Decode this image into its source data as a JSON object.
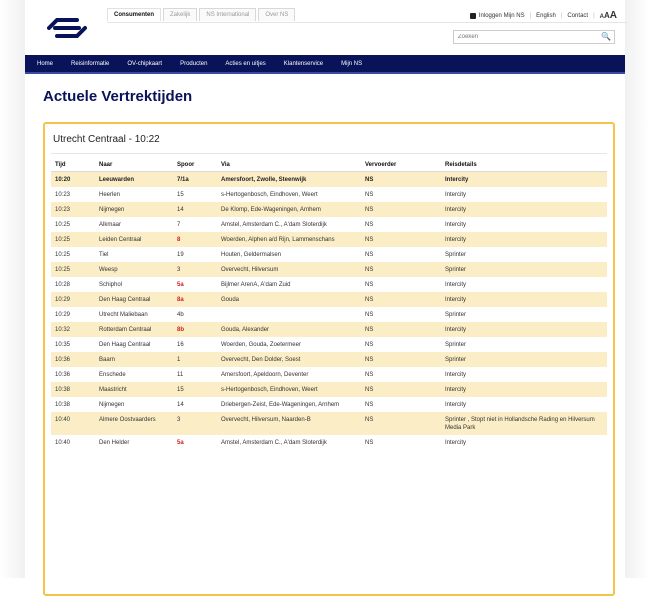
{
  "header": {
    "tabs": [
      "Consumenten",
      "Zakelijk",
      "NS International",
      "Over NS"
    ],
    "active_tab": 0,
    "utils": {
      "login": "Inloggen Mijn NS",
      "english": "English",
      "contact": "Contact",
      "font_sizes": [
        "A",
        "A",
        "A"
      ]
    },
    "search_placeholder": "Zoeken"
  },
  "nav": [
    "Home",
    "Reisinformatie",
    "OV-chipkaart",
    "Producten",
    "Acties en uitjes",
    "Klantenservice",
    "Mijn NS"
  ],
  "page_title": "Actuele Vertrektijden",
  "board": {
    "title": "Utrecht Centraal - 10:22",
    "columns": [
      "Tijd",
      "Naar",
      "Spoor",
      "Via",
      "Vervoerder",
      "Reisdetails"
    ],
    "rows": [
      {
        "tijd": "10:20",
        "naar": "Leeuwarden",
        "spoor": "7/1a",
        "spoor_changed": true,
        "via": "Amersfoort, Zwolle, Steenwijk",
        "vervoerder": "NS",
        "details": "Intercity"
      },
      {
        "tijd": "10:23",
        "naar": "Heerlen",
        "spoor": "15",
        "spoor_changed": false,
        "via": "s-Hertogenbosch, Eindhoven, Weert",
        "vervoerder": "NS",
        "details": "Intercity"
      },
      {
        "tijd": "10:23",
        "naar": "Nijmegen",
        "spoor": "14",
        "spoor_changed": false,
        "via": "De Klomp, Ede-Wageningen, Arnhem",
        "vervoerder": "NS",
        "details": "Intercity"
      },
      {
        "tijd": "10:25",
        "naar": "Alkmaar",
        "spoor": "7",
        "spoor_changed": false,
        "via": "Amstel, Amsterdam C., A'dam Sloterdijk",
        "vervoerder": "NS",
        "details": "Intercity"
      },
      {
        "tijd": "10:25",
        "naar": "Leiden Centraal",
        "spoor": "8",
        "spoor_changed": true,
        "via": "Woerden, Alphen a/d Rijn, Lammenschans",
        "vervoerder": "NS",
        "details": "Intercity"
      },
      {
        "tijd": "10:25",
        "naar": "Tiel",
        "spoor": "19",
        "spoor_changed": false,
        "via": "Houten, Geldermalsen",
        "vervoerder": "NS",
        "details": "Sprinter"
      },
      {
        "tijd": "10:25",
        "naar": "Weesp",
        "spoor": "3",
        "spoor_changed": false,
        "via": "Overvecht, Hilversum",
        "vervoerder": "NS",
        "details": "Sprinter"
      },
      {
        "tijd": "10:28",
        "naar": "Schiphol",
        "spoor": "5a",
        "spoor_changed": true,
        "via": "Bijlmer ArenA, A'dam Zuid",
        "vervoerder": "NS",
        "details": "Intercity"
      },
      {
        "tijd": "10:29",
        "naar": "Den Haag Centraal",
        "spoor": "8a",
        "spoor_changed": true,
        "via": "Gouda",
        "vervoerder": "NS",
        "details": "Intercity"
      },
      {
        "tijd": "10:29",
        "naar": "Utrecht Maliebaan",
        "spoor": "4b",
        "spoor_changed": false,
        "via": "",
        "vervoerder": "NS",
        "details": "Sprinter"
      },
      {
        "tijd": "10:32",
        "naar": "Rotterdam Centraal",
        "spoor": "8b",
        "spoor_changed": true,
        "via": "Gouda, Alexander",
        "vervoerder": "NS",
        "details": "Intercity"
      },
      {
        "tijd": "10:35",
        "naar": "Den Haag Centraal",
        "spoor": "16",
        "spoor_changed": false,
        "via": "Woerden, Gouda, Zoetermeer",
        "vervoerder": "NS",
        "details": "Sprinter"
      },
      {
        "tijd": "10:36",
        "naar": "Baarn",
        "spoor": "1",
        "spoor_changed": false,
        "via": "Overvecht, Den Dolder, Soest",
        "vervoerder": "NS",
        "details": "Sprinter"
      },
      {
        "tijd": "10:36",
        "naar": "Enschede",
        "spoor": "11",
        "spoor_changed": false,
        "via": "Amersfoort, Apeldoorn, Deventer",
        "vervoerder": "NS",
        "details": "Intercity"
      },
      {
        "tijd": "10:38",
        "naar": "Maastricht",
        "spoor": "15",
        "spoor_changed": false,
        "via": "s-Hertogenbosch, Eindhoven, Weert",
        "vervoerder": "NS",
        "details": "Intercity"
      },
      {
        "tijd": "10:38",
        "naar": "Nijmegen",
        "spoor": "14",
        "spoor_changed": false,
        "via": "Driebergen-Zeist, Ede-Wageningen, Arnhem",
        "vervoerder": "NS",
        "details": "Intercity"
      },
      {
        "tijd": "10:40",
        "naar": "Almere Oostvaarders",
        "spoor": "3",
        "spoor_changed": false,
        "via": "Overvecht, Hilversum, Naarden-B",
        "vervoerder": "NS",
        "details": "Sprinter , Stopt niet in Hollandsche Rading en Hilversum Media Park"
      },
      {
        "tijd": "10:40",
        "naar": "Den Helder",
        "spoor": "5a",
        "spoor_changed": true,
        "via": "Amstel, Amsterdam C., A'dam Sloterdijk",
        "vervoerder": "NS",
        "details": "Intercity"
      }
    ]
  },
  "colors": {
    "nav_bg": "#08135a",
    "alt_row": "#fbeec6",
    "board_border": "#f3c34a",
    "changed_track": "#d02020"
  }
}
